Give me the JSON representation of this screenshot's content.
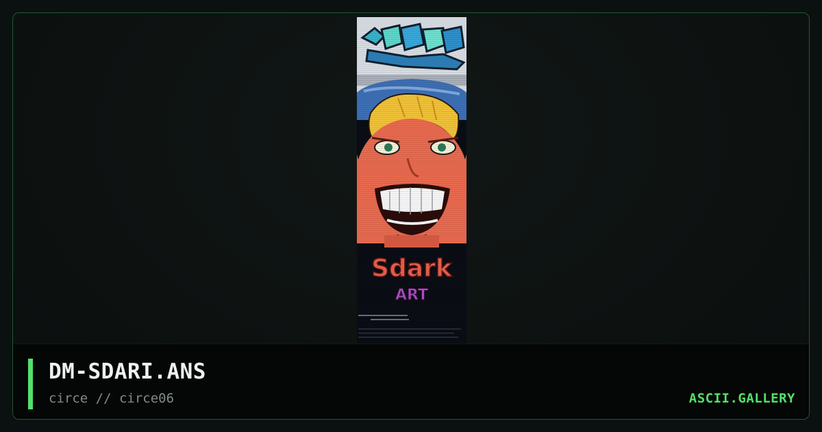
{
  "artwork": {
    "filename": "DM-SDARI.ANS",
    "byline": "circe // circe06",
    "logo_text": "Sdark"
  },
  "site": {
    "name": "ASCII.GALLERY"
  },
  "colors": {
    "accent": "#52e06a",
    "background": "#0b1110",
    "border": "#1f5a2c"
  }
}
